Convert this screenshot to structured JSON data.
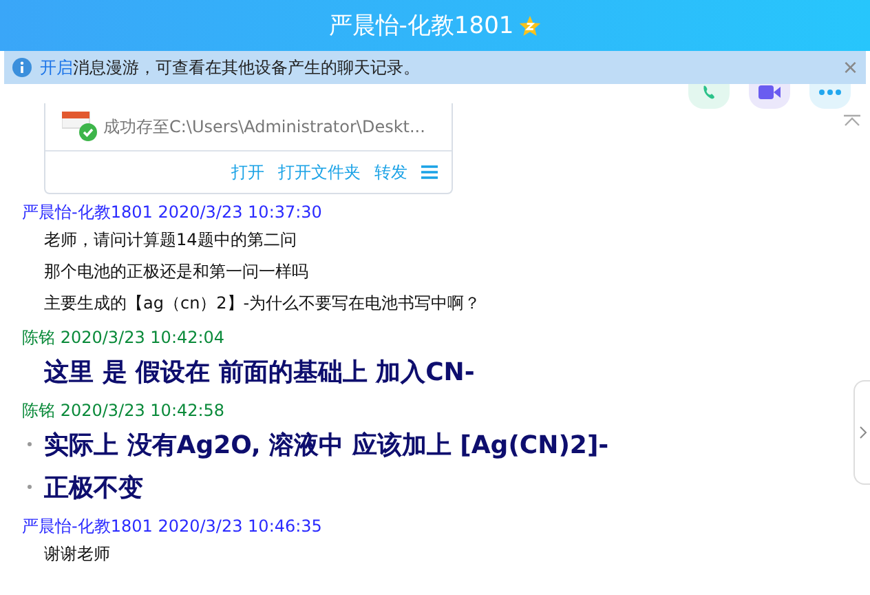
{
  "window": {
    "title": "严晨怡-化教1801"
  },
  "notice": {
    "link": "开启",
    "text": "消息漫游，可查看在其他设备产生的聊天记录。",
    "close": "×"
  },
  "file_card": {
    "status": "成功存至C:\\Users\\Administrator\\Deskt...",
    "actions": [
      "打开",
      "打开文件夹",
      "转发"
    ]
  },
  "messages": [
    {
      "sender": "严晨怡-化教1801",
      "time": "2020/3/23 10:37:30",
      "color": "#2a2aff",
      "lines": [
        {
          "text": "老师，请问计算题14题中的第二问",
          "kind": "normal"
        },
        {
          "text": "那个电池的正极还是和第一问一样吗",
          "kind": "normal"
        },
        {
          "text": "主要生成的【ag（cn）2】-为什么不要写在电池书写中啊？",
          "kind": "normal"
        }
      ]
    },
    {
      "sender": "陈铭",
      "time": "2020/3/23 10:42:04",
      "color": "#0a8a3a",
      "lines": [
        {
          "text": "这里 是 假设在 前面的基础上  加入CN-",
          "kind": "large",
          "bullet": false
        }
      ]
    },
    {
      "sender": "陈铭",
      "time": "2020/3/23 10:42:58",
      "color": "#0a8a3a",
      "lines": [
        {
          "text": "实际上 没有Ag2O, 溶液中 应该加上 [Ag(CN)2]-",
          "kind": "large",
          "bullet": true
        },
        {
          "text": "正极不变",
          "kind": "large",
          "bullet": true
        }
      ]
    },
    {
      "sender": "严晨怡-化教1801",
      "time": "2020/3/23 10:46:35",
      "color": "#2a2aff",
      "lines": [
        {
          "text": "谢谢老师",
          "kind": "normal"
        }
      ]
    }
  ]
}
